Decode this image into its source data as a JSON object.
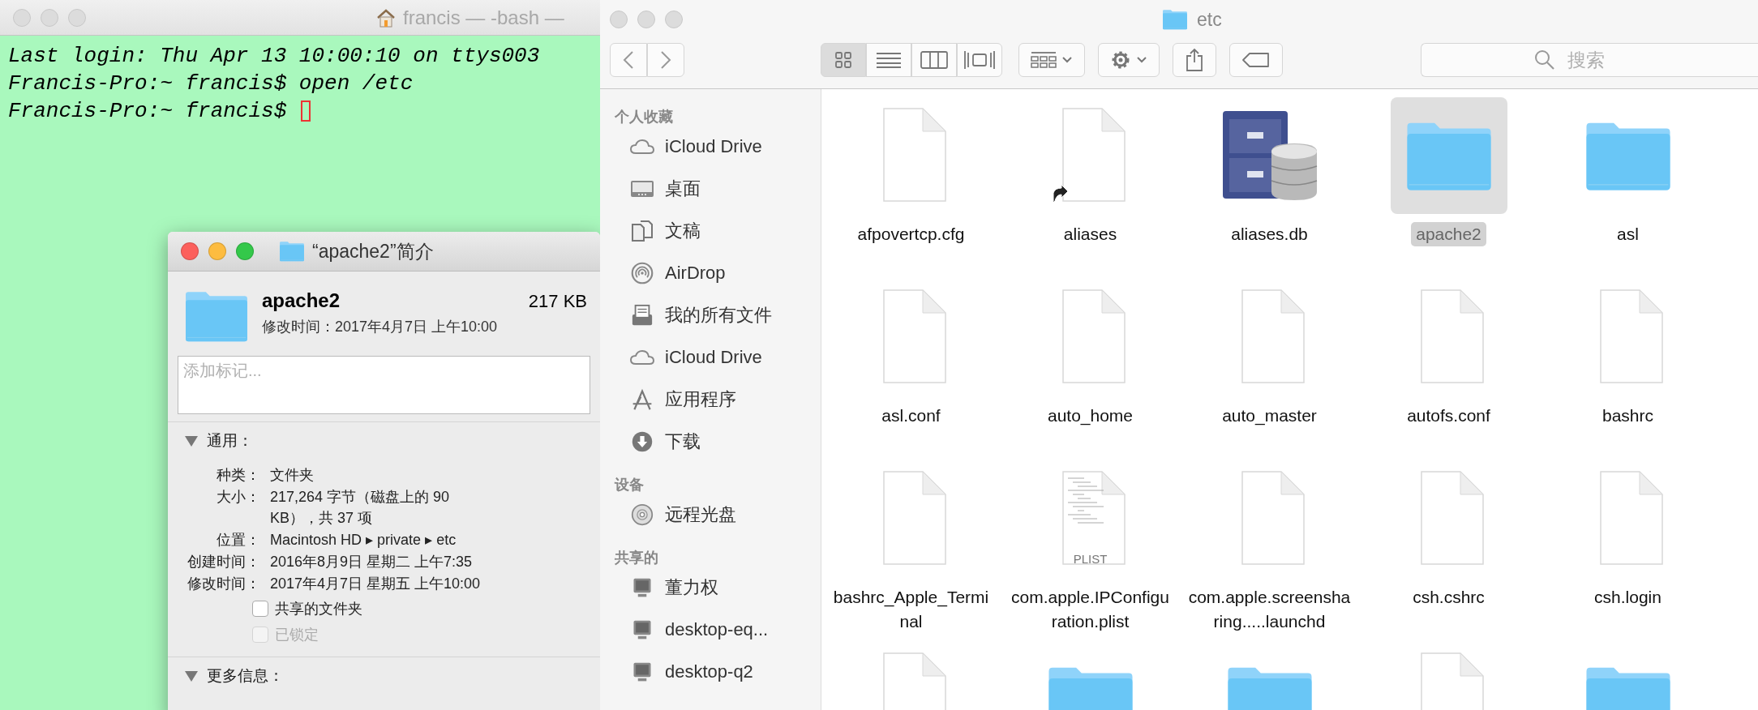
{
  "terminal": {
    "title": "francis — -bash —",
    "active": false,
    "cursor": true,
    "lines": [
      "Last login: Thu Apr 13 10:00:10 on ttys003",
      "Francis-Pro:~ francis$ open /etc",
      "Francis-Pro:~ francis$ "
    ]
  },
  "info_window": {
    "title": "“apache2”简介",
    "active": true,
    "name": "apache2",
    "size": "217 KB",
    "modified_summary": "修改时间：2017年4月7日 上午10:00",
    "tags": {
      "placeholder": "添加标记..."
    },
    "sections": [
      {
        "title": "通用：",
        "expanded": true,
        "rows": [
          {
            "label": "种类：",
            "value": "文件夹"
          },
          {
            "label": "大小：",
            "value": "217,264 字节（磁盘上的 90 KB），共 37 项"
          },
          {
            "label": "位置：",
            "value": "Macintosh HD ▸ private ▸ etc"
          },
          {
            "label": "创建时间：",
            "value": "2016年8月9日 星期二 上午7:35"
          },
          {
            "label": "修改时间：",
            "value": "2017年4月7日 星期五 上午10:00"
          }
        ],
        "checkboxes": [
          {
            "label": "共享的文件夹",
            "checked": false,
            "disabled": false
          },
          {
            "label": "已锁定",
            "checked": false,
            "disabled": true
          }
        ]
      },
      {
        "title": "更多信息：",
        "expanded": true
      }
    ]
  },
  "finder": {
    "title": "etc",
    "active": false,
    "view_buttons": [
      {
        "kind": "icons",
        "selected": true
      },
      {
        "kind": "list",
        "selected": false
      },
      {
        "kind": "columns",
        "selected": false
      },
      {
        "kind": "coverflow",
        "selected": false
      }
    ],
    "search": {
      "placeholder": "搜索"
    },
    "sidebar": [
      {
        "title": "个人收藏",
        "items": [
          {
            "label": "iCloud Drive",
            "kind": "cloud"
          },
          {
            "label": "桌面",
            "kind": "desktop"
          },
          {
            "label": "文稿",
            "kind": "documents"
          },
          {
            "label": "AirDrop",
            "kind": "airdrop"
          },
          {
            "label": "我的所有文件",
            "kind": "allfiles"
          },
          {
            "label": "iCloud Drive",
            "kind": "cloud"
          },
          {
            "label": "应用程序",
            "kind": "apps"
          },
          {
            "label": "下载",
            "kind": "download"
          }
        ]
      },
      {
        "title": "设备",
        "items": [
          {
            "label": "远程光盘",
            "kind": "disc"
          }
        ]
      },
      {
        "title": "共享的",
        "items": [
          {
            "label": "董力权",
            "kind": "computer"
          },
          {
            "label": "desktop-eq...",
            "kind": "computer"
          },
          {
            "label": "desktop-q2",
            "kind": "computer"
          }
        ]
      }
    ],
    "files": [
      {
        "label": "afpovertcp.cfg",
        "kind": "file",
        "selected": false
      },
      {
        "label": "aliases",
        "kind": "alias",
        "selected": false
      },
      {
        "label": "aliases.db",
        "kind": "database",
        "selected": false
      },
      {
        "label": "apache2",
        "kind": "folder",
        "selected": true
      },
      {
        "label": "asl",
        "kind": "folder",
        "selected": false
      },
      {
        "label": "asl.conf",
        "kind": "file",
        "selected": false
      },
      {
        "label": "auto_home",
        "kind": "file",
        "selected": false
      },
      {
        "label": "auto_master",
        "kind": "file",
        "selected": false
      },
      {
        "label": "autofs.conf",
        "kind": "file",
        "selected": false
      },
      {
        "label": "bashrc",
        "kind": "file",
        "selected": false
      },
      {
        "label": "bashrc_Apple_Terminal",
        "kind": "file",
        "selected": false
      },
      {
        "label": "com.apple.IPConfiguration.plist",
        "kind": "plist",
        "badge": "PLIST",
        "selected": false
      },
      {
        "label": "com.apple.screensharing.....launchd",
        "kind": "file",
        "selected": false
      },
      {
        "label": "csh.cshrc",
        "kind": "file",
        "selected": false
      },
      {
        "label": "csh.login",
        "kind": "file",
        "selected": false
      },
      {
        "kind": "file",
        "selected": false
      },
      {
        "kind": "folder",
        "selected": false
      },
      {
        "kind": "folder",
        "selected": false
      },
      {
        "kind": "file",
        "selected": false
      },
      {
        "kind": "folder",
        "selected": false
      }
    ]
  }
}
